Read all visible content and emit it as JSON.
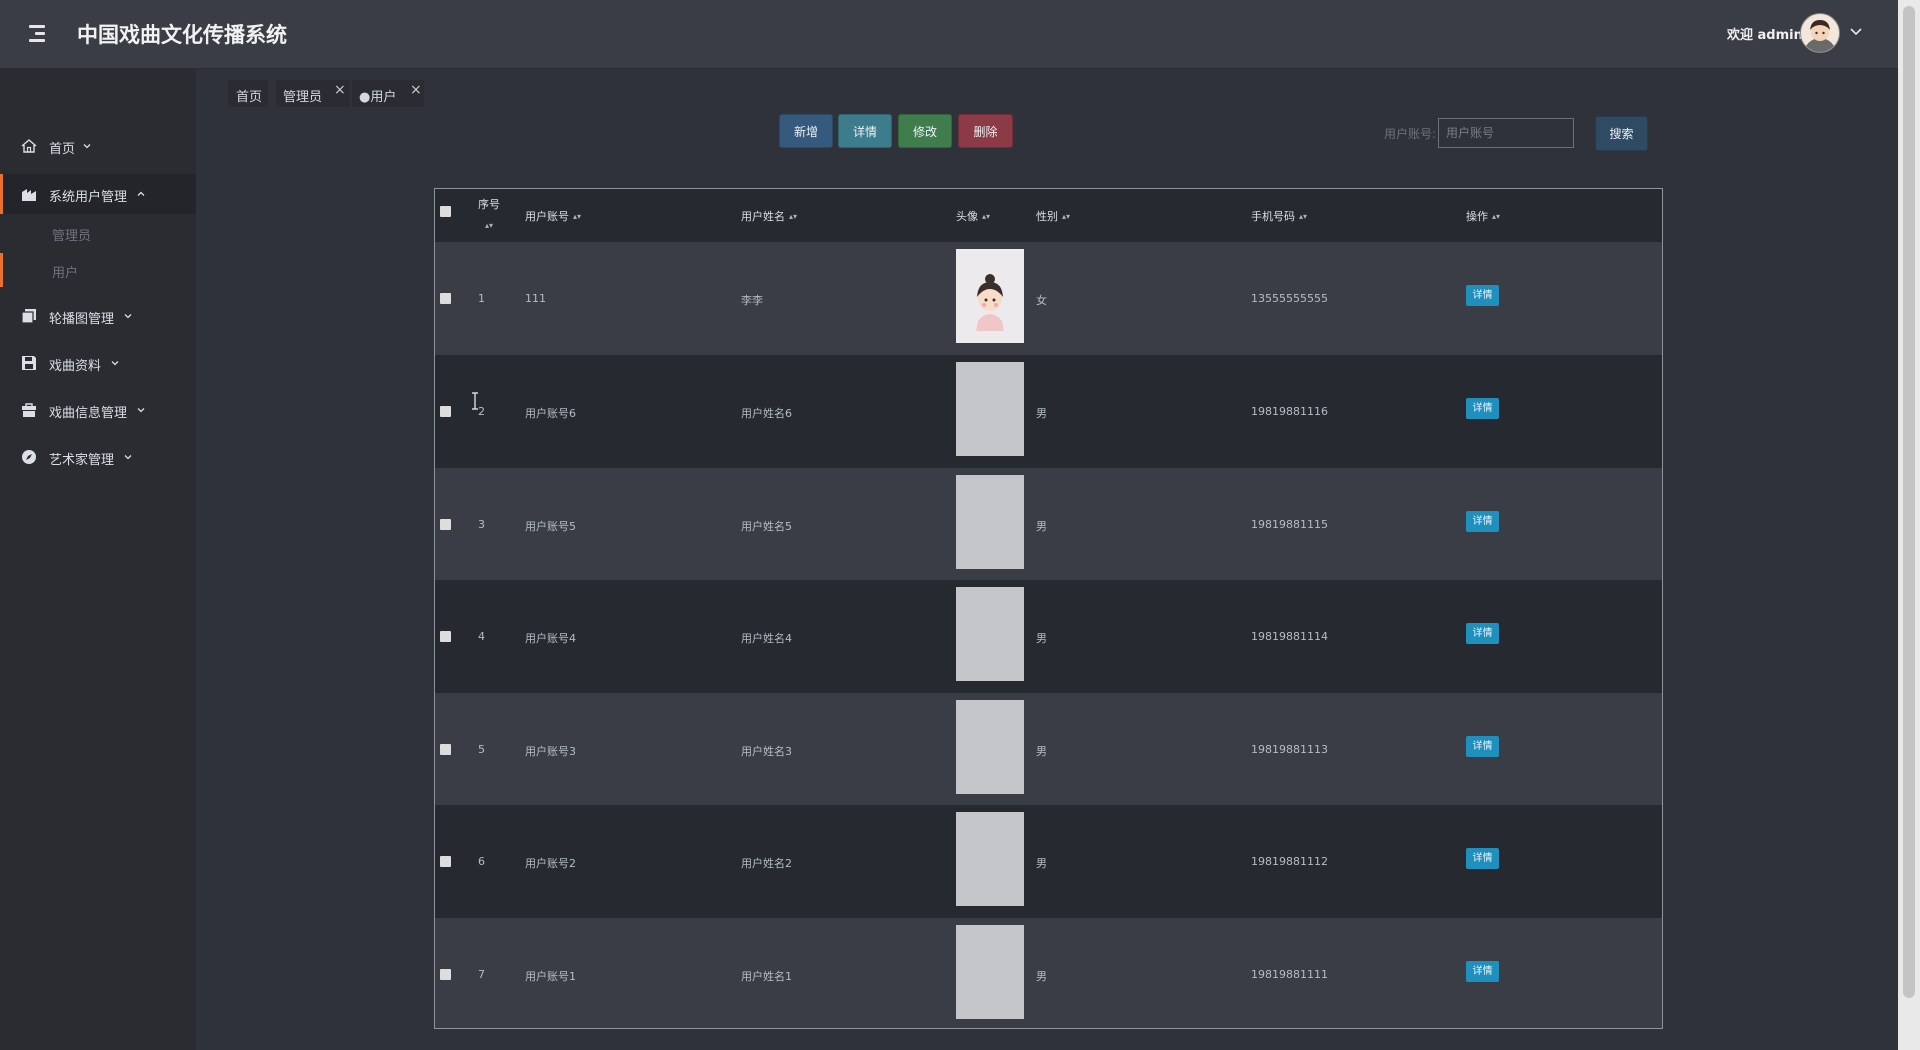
{
  "app": {
    "title": "中国戏曲文化传播系统"
  },
  "user": {
    "welcome": "欢迎 admin"
  },
  "sidebar": {
    "items": [
      {
        "label": "首页",
        "icon": "home-icon"
      },
      {
        "label": "系统用户管理",
        "icon": "building-icon",
        "expanded": true,
        "children": [
          {
            "label": "管理员"
          },
          {
            "label": "用户"
          }
        ]
      },
      {
        "label": "轮播图管理",
        "icon": "copy-icon"
      },
      {
        "label": "戏曲资料",
        "icon": "save-icon"
      },
      {
        "label": "戏曲信息管理",
        "icon": "bag-icon"
      },
      {
        "label": "艺术家管理",
        "icon": "compass-icon"
      }
    ]
  },
  "tabs": [
    {
      "label": "首页"
    },
    {
      "label": "管理员",
      "closable": true
    },
    {
      "label": "●用户",
      "closable": true,
      "active": true
    }
  ],
  "toolbar": {
    "add": "新增",
    "detail": "详情",
    "edit": "修改",
    "delete": "删除"
  },
  "search": {
    "label": "用户账号:",
    "placeholder": "用户账号",
    "button": "搜索"
  },
  "colors": {
    "accent": "#e9712e",
    "add": "#365a7e",
    "detail": "#3d7c8c",
    "edit": "#3f7d4d",
    "delete": "#8c3a46",
    "op": "#1f8fbe"
  },
  "table": {
    "headers": [
      "序号",
      "用户账号",
      "用户姓名",
      "头像",
      "性别",
      "手机号码",
      "操作"
    ],
    "rows": [
      {
        "index": "1",
        "account": "111",
        "name": "李李",
        "gender": "女",
        "phone": "13555555555",
        "action": "详情",
        "has_avatar": true
      },
      {
        "index": "2",
        "account": "用户账号6",
        "name": "用户姓名6",
        "gender": "男",
        "phone": "19819881116",
        "action": "详情",
        "has_avatar": false
      },
      {
        "index": "3",
        "account": "用户账号5",
        "name": "用户姓名5",
        "gender": "男",
        "phone": "19819881115",
        "action": "详情",
        "has_avatar": false
      },
      {
        "index": "4",
        "account": "用户账号4",
        "name": "用户姓名4",
        "gender": "男",
        "phone": "19819881114",
        "action": "详情",
        "has_avatar": false
      },
      {
        "index": "5",
        "account": "用户账号3",
        "name": "用户姓名3",
        "gender": "男",
        "phone": "19819881113",
        "action": "详情",
        "has_avatar": false
      },
      {
        "index": "6",
        "account": "用户账号2",
        "name": "用户姓名2",
        "gender": "男",
        "phone": "19819881112",
        "action": "详情",
        "has_avatar": false
      },
      {
        "index": "7",
        "account": "用户账号1",
        "name": "用户姓名1",
        "gender": "男",
        "phone": "19819881111",
        "action": "详情",
        "has_avatar": false
      }
    ]
  }
}
